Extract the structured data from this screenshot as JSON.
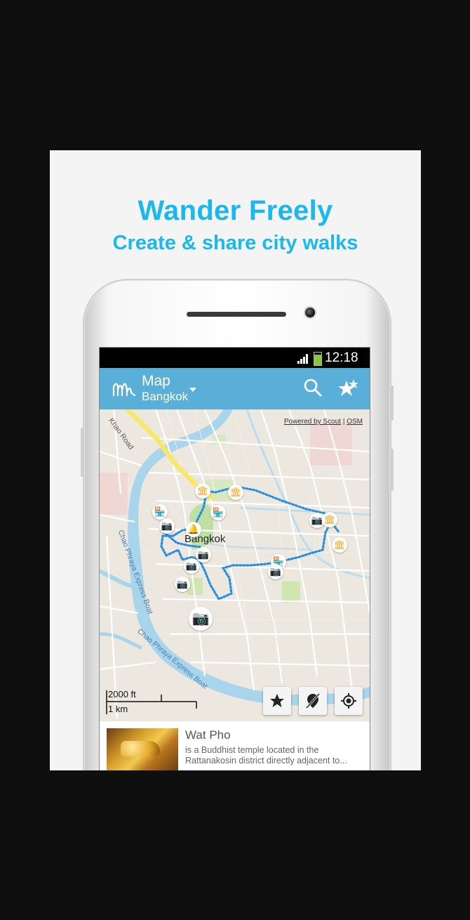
{
  "promo": {
    "headline": "Wander Freely",
    "subline": "Create & share city walks"
  },
  "status_bar": {
    "time": "12:18",
    "icons": [
      "signal-icon",
      "battery-icon"
    ]
  },
  "app_bar": {
    "title": "Map",
    "city": "Bangkok",
    "icons": [
      "app-logo-icon",
      "dropdown-caret-icon",
      "search-icon",
      "favorites-star-icon"
    ],
    "color": "#5aafd9"
  },
  "map": {
    "attribution": {
      "powered_by": "Powered by Scout",
      "separator": " | ",
      "source": "OSM"
    },
    "city_label": "Bangkok",
    "road_labels": [
      "Chao Phraya Express Boat",
      "Chao Phraya Express Boat",
      "Khao Road"
    ],
    "scale": {
      "feet": "2000 ft",
      "km": "1 km"
    },
    "buttons": [
      "favorites-star-icon",
      "no-location-icon",
      "my-location-icon"
    ],
    "route_color": "#2a8ee0",
    "poi_color": "#f5a623",
    "river_color": "#a8d4ec"
  },
  "detail": {
    "name": "Wat Pho",
    "description": "is a Buddhist temple located in the Rattanakosin district directly adjacent to..."
  }
}
